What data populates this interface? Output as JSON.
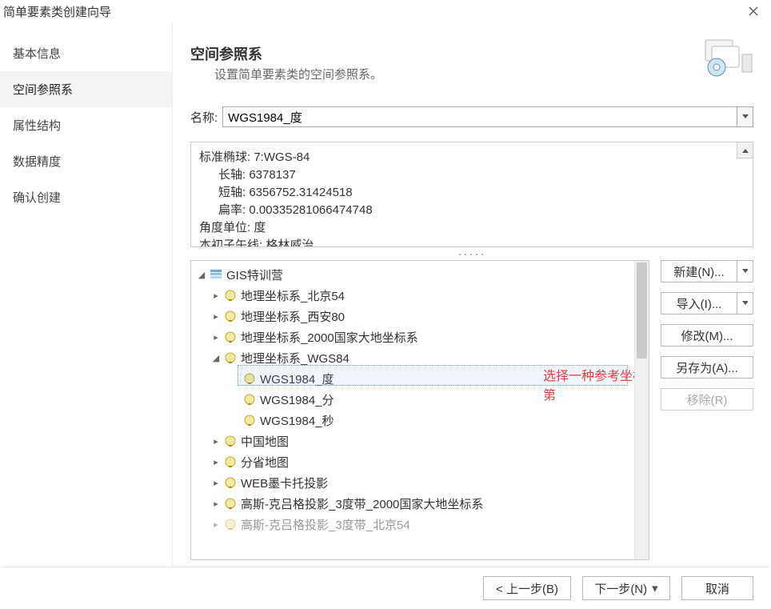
{
  "window": {
    "title": "简单要素类创建向导"
  },
  "sidebar": {
    "items": [
      {
        "label": "基本信息"
      },
      {
        "label": "空间参照系"
      },
      {
        "label": "属性结构"
      },
      {
        "label": "数据精度"
      },
      {
        "label": "确认创建"
      }
    ],
    "selected": 1
  },
  "header": {
    "title": "空间参照系",
    "subtitle": "设置简单要素类的空间参照系。"
  },
  "name_field": {
    "label": "名称:",
    "value": "WGS1984_度"
  },
  "info": {
    "ellipsoid_label": "标准椭球:",
    "ellipsoid_value": "7:WGS-84",
    "major_label": "长轴:",
    "major_value": "6378137",
    "minor_label": "短轴:",
    "minor_value": "6356752.31424518",
    "flat_label": "扁率:",
    "flat_value": "0.00335281066474748",
    "angle_label": "角度单位:",
    "angle_value": "度",
    "pm_label": "本初子午线:",
    "pm_value": "格林威治"
  },
  "tree": {
    "root": "GIS特训营",
    "nodes": [
      "地理坐标系_北京54",
      "地理坐标系_西安80",
      "地理坐标系_2000国家大地坐标系",
      "地理坐标系_WGS84",
      "中国地图",
      "分省地图",
      "WEB墨卡托投影",
      "高斯-克吕格投影_3度带_2000国家大地坐标系",
      "高斯-克吕格投影_3度带_北京54"
    ],
    "wgs84_children": [
      "WGS1984_度",
      "WGS1984_分",
      "WGS1984_秒"
    ],
    "selected_leaf": "WGS1984_度"
  },
  "overlay_note": "选择一种参考坐标第",
  "buttons": {
    "new": "新建(N)...",
    "import": "导入(I)...",
    "modify": "修改(M)...",
    "saveas": "另存为(A)...",
    "remove": "移除(R)"
  },
  "footer": {
    "prev": "< 上一步(B)",
    "next": "下一步(N)",
    "cancel": "取消"
  }
}
